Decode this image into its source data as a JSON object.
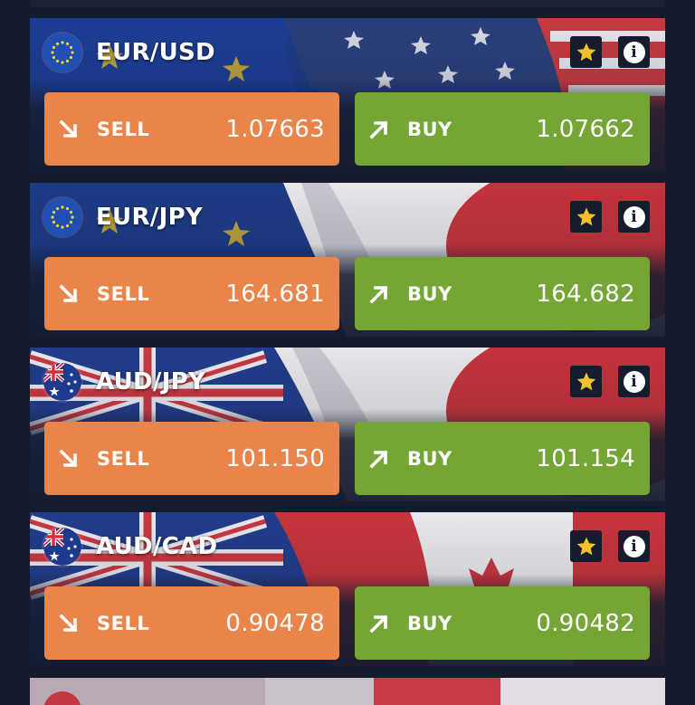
{
  "instruments": [
    {
      "pair": "EUR/USD",
      "base_flag": "eu-flag-icon",
      "sell_label": "SELL",
      "sell_price": "1.07663",
      "buy_label": "BUY",
      "buy_price": "1.07662",
      "favorite": true
    },
    {
      "pair": "EUR/JPY",
      "base_flag": "eu-flag-icon",
      "sell_label": "SELL",
      "sell_price": "164.681",
      "buy_label": "BUY",
      "buy_price": "164.682",
      "favorite": true
    },
    {
      "pair": "AUD/JPY",
      "base_flag": "au-flag-icon",
      "sell_label": "SELL",
      "sell_price": "101.150",
      "buy_label": "BUY",
      "buy_price": "101.154",
      "favorite": true
    },
    {
      "pair": "AUD/CAD",
      "base_flag": "au-flag-icon",
      "sell_label": "SELL",
      "sell_price": "0.90478",
      "buy_label": "BUY",
      "buy_price": "0.90482",
      "favorite": true
    }
  ],
  "colors": {
    "background": "#141b2d",
    "sell": "#e9854a",
    "buy": "#74a535",
    "favorite_star": "#f2c12e"
  },
  "icons": {
    "favorite": "star-icon",
    "info": "info-icon",
    "sell": "arrow-down-right-icon",
    "buy": "arrow-up-right-icon"
  }
}
